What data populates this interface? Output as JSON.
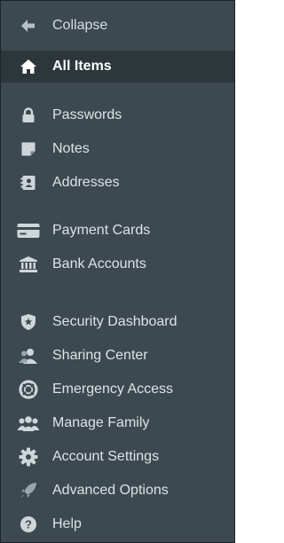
{
  "sidebar": {
    "collapse": {
      "label": "Collapse",
      "icon": "arrow-left-icon"
    },
    "items": [
      {
        "label": "All Items",
        "icon": "home-icon",
        "active": true
      },
      {
        "label": "Passwords",
        "icon": "lock-icon"
      },
      {
        "label": "Notes",
        "icon": "note-icon"
      },
      {
        "label": "Addresses",
        "icon": "address-book-icon"
      },
      {
        "label": "Payment Cards",
        "icon": "credit-card-icon"
      },
      {
        "label": "Bank Accounts",
        "icon": "bank-icon"
      },
      {
        "label": "Security Dashboard",
        "icon": "shield-star-icon"
      },
      {
        "label": "Sharing Center",
        "icon": "share-user-icon"
      },
      {
        "label": "Emergency Access",
        "icon": "life-ring-icon"
      },
      {
        "label": "Manage Family",
        "icon": "family-icon"
      },
      {
        "label": "Account Settings",
        "icon": "gear-icon"
      },
      {
        "label": "Advanced Options",
        "icon": "rocket-icon"
      },
      {
        "label": "Help",
        "icon": "help-icon"
      }
    ]
  },
  "colors": {
    "background": "#3d4950",
    "active_background": "#2c363b",
    "text": "#dde3e6",
    "icon": "#cfd6da"
  }
}
